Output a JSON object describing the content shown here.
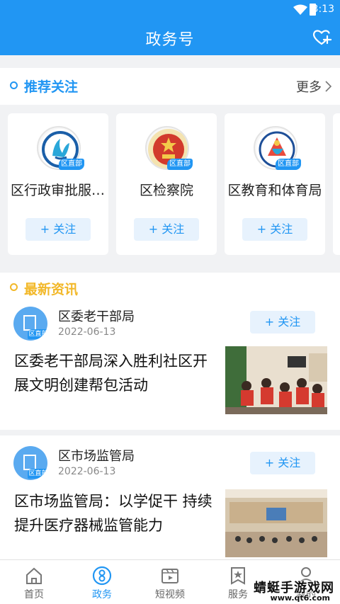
{
  "status_bar": {
    "time": "3:13"
  },
  "header": {
    "title": "政务号"
  },
  "recommend": {
    "title": "推荐关注",
    "more": "更多",
    "cards": [
      {
        "name": "区行政审批服务局",
        "tag": "区直部门",
        "follow": "+ 关注"
      },
      {
        "name": "区检察院",
        "tag": "区直部门",
        "follow": "+ 关注"
      },
      {
        "name": "区教育和体育局",
        "tag": "区直部门",
        "follow": "+ 关注"
      }
    ]
  },
  "news": {
    "title": "最新资讯",
    "items": [
      {
        "org": "区委老干部局",
        "date": "2022-06-13",
        "tag": "区直部门",
        "follow": "+ 关注",
        "headline": "区委老干部局深入胜利社区开展文明创建帮包活动"
      },
      {
        "org": "区市场监管局",
        "date": "2022-06-13",
        "tag": "区直部门",
        "follow": "+ 关注",
        "headline": "区市场监管局：以学促干 持续提升医疗器械监管能力"
      }
    ]
  },
  "tabbar": {
    "tabs": [
      {
        "label": "首页"
      },
      {
        "label": "政务"
      },
      {
        "label": "短视频"
      },
      {
        "label": "服务"
      },
      {
        "label": "我的"
      }
    ],
    "active_index": 1
  },
  "watermark": {
    "line1": "蜻蜓手游戏网",
    "line2": "www.qt6.com"
  },
  "colors": {
    "primary": "#2196f3",
    "accent_yellow": "#f2b829"
  }
}
